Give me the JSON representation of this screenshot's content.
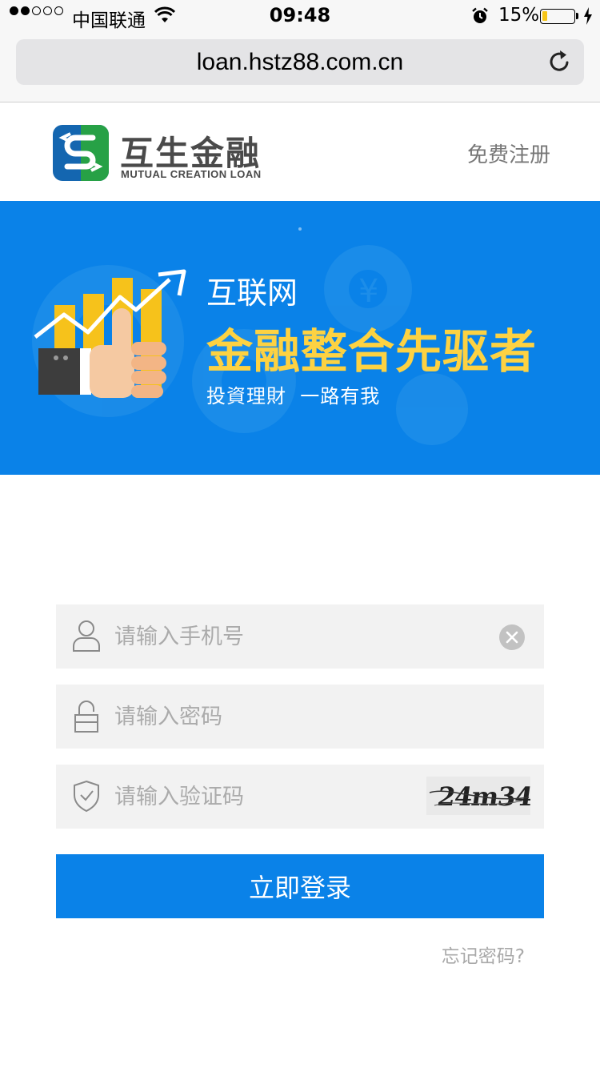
{
  "status_bar": {
    "carrier": "中国联通",
    "time": "09:48",
    "battery_percent_label": "15%",
    "battery_level": 0.15,
    "signal_bars_filled": 2,
    "signal_bars_total": 5
  },
  "browser": {
    "url": "loan.hstz88.com.cn"
  },
  "header": {
    "brand_cn": "互生金融",
    "brand_en": "MUTUAL CREATION LOAN",
    "register_link": "免费注册"
  },
  "banner": {
    "line1": "互联网",
    "line2": "金融整合先驱者",
    "line3": "投資理財  一路有我"
  },
  "form": {
    "phone_placeholder": "请输入手机号",
    "password_placeholder": "请输入密码",
    "captcha_placeholder": "请输入验证码",
    "captcha_text": "24m34",
    "login_button": "立即登录",
    "forgot_password": "忘记密码?"
  },
  "colors": {
    "primary": "#0A82E8",
    "banner_highlight": "#FDD242",
    "field_background": "#F2F2F2",
    "logo_blue": "#1466B0",
    "logo_green": "#27A146"
  }
}
